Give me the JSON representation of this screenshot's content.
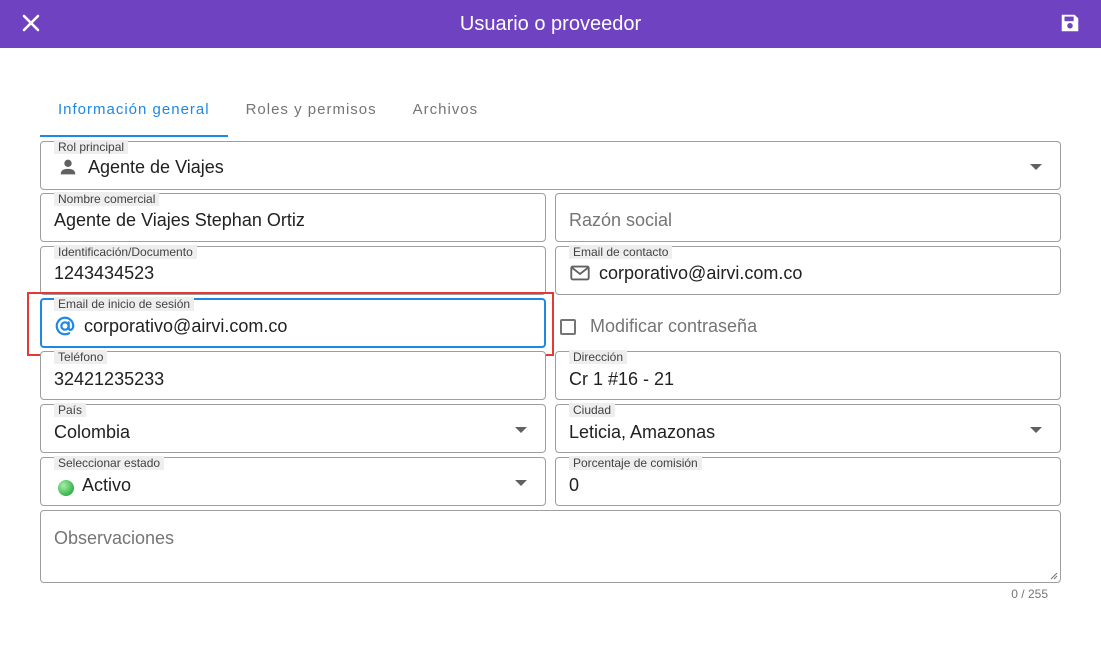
{
  "header": {
    "title": "Usuario o proveedor",
    "close_icon": "close-icon",
    "save_icon": "save-icon",
    "background": "#6f42c1"
  },
  "tabs": [
    {
      "label": "Información general",
      "active": true
    },
    {
      "label": "Roles y permisos",
      "active": false
    },
    {
      "label": "Archivos",
      "active": false
    }
  ],
  "form": {
    "rol_principal": {
      "label": "Rol principal",
      "value": "Agente de Viajes",
      "icon": "person-icon"
    },
    "nombre_comercial": {
      "label": "Nombre comercial",
      "value": "Agente de Viajes Stephan Ortiz"
    },
    "razon_social": {
      "placeholder": "Razón social"
    },
    "identificacion": {
      "label": "Identificación/Documento",
      "value": "1243434523"
    },
    "email_contacto": {
      "label": "Email de contacto",
      "value": "corporativo@airvi.com.co",
      "icon": "mail-icon"
    },
    "email_login": {
      "label": "Email de inicio de sesión",
      "value": "corporativo@airvi.com.co",
      "icon": "at-icon"
    },
    "modificar_contrasena": {
      "label": "Modificar contraseña",
      "checked": false
    },
    "telefono": {
      "label": "Teléfono",
      "value": "32421235233"
    },
    "direccion": {
      "label": "Dirección",
      "value": "Cr 1 #16 - 21"
    },
    "pais": {
      "label": "País",
      "value": "Colombia"
    },
    "ciudad": {
      "label": "Ciudad",
      "value": "Leticia, Amazonas"
    },
    "estado": {
      "label": "Seleccionar estado",
      "value": "Activo",
      "color": "#37b24d"
    },
    "comision": {
      "label": "Porcentaje de comisión",
      "value": "0"
    },
    "observaciones": {
      "placeholder": "Observaciones",
      "counter": "0 / 255"
    }
  },
  "colors": {
    "accent": "#1e88e5",
    "highlight": "#e53935"
  }
}
